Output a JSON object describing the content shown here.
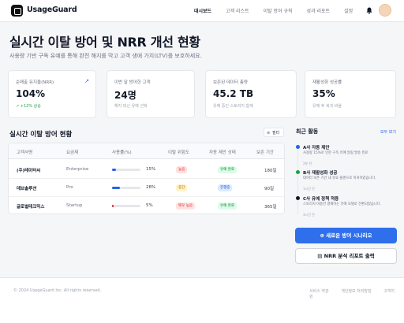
{
  "app": {
    "name": "UsageGuard"
  },
  "nav": {
    "items": [
      "대시보드",
      "고객 리스트",
      "이탈 방어 규칙",
      "성과 리포트",
      "설정"
    ],
    "active": 0
  },
  "page": {
    "title": "실시간 이탈 방어 및 NRR 개선 현황",
    "subtitle": "사용량 기반 구독 유예를 통해 완전 해지를 막고 고객 생애 가치(LTV)를 보호하세요."
  },
  "metrics": [
    {
      "label": "순매출 유지율(NRR)",
      "value": "104%",
      "note": "+12% 상승"
    },
    {
      "label": "이번 달 방어한 고객",
      "value": "24명",
      "note": "해지 대신 유예 선택"
    },
    {
      "label": "보존된 데이터 총량",
      "value": "45.2 TB",
      "note": "유예 중인 스토리지 합계"
    },
    {
      "label": "재활성화 성공률",
      "value": "35%",
      "note": "유예 후 복귀 비율"
    }
  ],
  "table": {
    "title": "실시간 이탈 방어 현황",
    "filter_label": "필터",
    "columns": [
      "고객사명",
      "요금제",
      "사용률(%)",
      "이탈 위험도",
      "자동 제안 상태",
      "보존 기간"
    ],
    "rows": [
      {
        "name": "(주)테이터씨",
        "plan": "Enterprise",
        "usage": 15,
        "usage_label": "15%",
        "risk": "높음",
        "status": "유예 완료",
        "period": "180일"
      },
      {
        "name": "데브솔루션",
        "plan": "Pro",
        "usage": 28,
        "usage_label": "28%",
        "risk": "중간",
        "status": "진행중",
        "period": "90일"
      },
      {
        "name": "글로벌테크믹스",
        "plan": "Startup",
        "usage": 5,
        "usage_label": "5%",
        "risk": "매우 높음",
        "status": "유예 완료",
        "period": "365일"
      }
    ]
  },
  "activity": {
    "title": "최근 활동",
    "see_all": "모두 보기",
    "items": [
      {
        "title": "A사 자동 제안",
        "desc": "사용량 15%로 인한 구독 유예 알림 발송 완료",
        "time": "2분 전",
        "color": "#2563eb"
      },
      {
        "title": "B사 재활성화 성공",
        "desc": "데이터 보존 기간 내 유료 플랜으로 복귀하였습니다.",
        "time": "1시간 전",
        "color": "#16a34a"
      },
      {
        "title": "C사 유예 정책 적용",
        "desc": "스토리지 비용만 결제하는 유예 모델로 전환되었습니다.",
        "time": "3시간 전",
        "color": "#111827"
      }
    ]
  },
  "actions": {
    "primary": "새로운 방어 시나리오",
    "secondary": "NRR 분석 리포트 출력"
  },
  "footer": {
    "copyright": "© 2024 UsageGuard Inc. All rights reserved.",
    "links": [
      "서비스 약관",
      "개인정보 처리방침",
      "고객지원"
    ]
  },
  "colors": {
    "accent": "#2f6feb",
    "bar_low": "#2563eb",
    "bar_critical": "#dc2626",
    "risk_high_bg": "#fee2e2",
    "risk_high_fg": "#dc2626",
    "risk_mid_bg": "#fef3c7",
    "risk_mid_fg": "#b45309",
    "status_done_bg": "#dcfce7",
    "status_done_fg": "#15803d",
    "status_progress_bg": "#dbeafe",
    "status_progress_fg": "#1d4ed8"
  }
}
